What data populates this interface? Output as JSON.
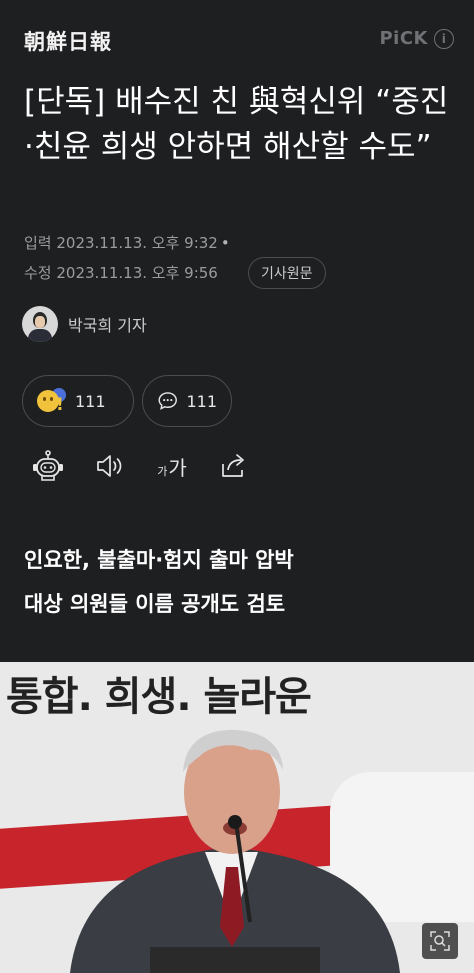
{
  "header": {
    "logo": "朝鮮日報",
    "pick_label": "PiCK",
    "info_icon": "i"
  },
  "article": {
    "headline": "[단독] 배수진 친 與혁신위 “중진·친윤 희생 안하면 해산할 수도”",
    "input_label": "입력 2023.11.13. 오후 9:32",
    "modified_label": "수정 2023.11.13. 오후 9:56",
    "original_button": "기사원문",
    "reporter": "박국희 기자",
    "reaction_count": "111",
    "comment_count": "111",
    "font_small": "가",
    "font_large": "가",
    "subhead_line1": "인요한, 불출마·험지 출마 압박",
    "subhead_line2": "대상 의원들 이름 공개도 검토"
  },
  "photo": {
    "banner_text": "통합. 희생. 놀라운"
  },
  "colors": {
    "background": "#1e1f21",
    "text": "#ffffff",
    "muted": "#9a9ca0",
    "border": "#4a4c50",
    "banner_red": "#c8242b"
  },
  "icons": [
    "info-icon",
    "reaction-emoji-icon",
    "comment-icon",
    "robot-icon",
    "speaker-icon",
    "font-size-icon",
    "share-icon",
    "zoom-icon"
  ]
}
